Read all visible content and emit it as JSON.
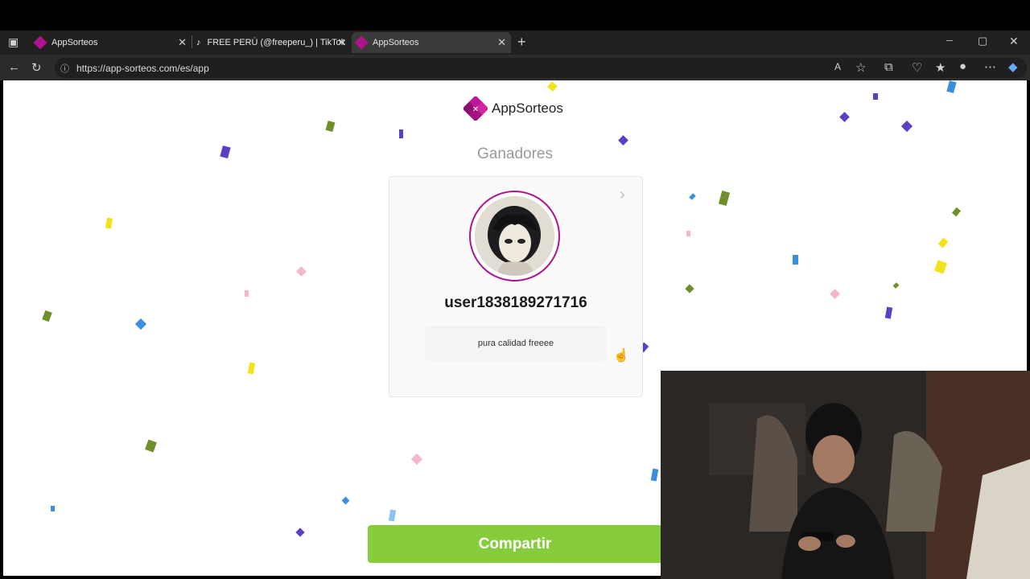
{
  "browser": {
    "tabs": [
      {
        "title": "AppSorteos",
        "active": false
      },
      {
        "title": "FREE PERÚ (@freeperu_) | TikTok",
        "active": false
      },
      {
        "title": "AppSorteos",
        "active": true
      }
    ],
    "new_tab": "+",
    "url": "https://app-sorteos.com/es/app",
    "window_controls": {
      "minimize": "─",
      "maximize": "▢",
      "close": "✕"
    }
  },
  "app": {
    "brand": "AppSorteos",
    "heading": "Ganadores",
    "winner": {
      "username": "user1838189271716",
      "comment": "pura calidad freeee"
    },
    "share_label": "Compartir"
  },
  "colors": {
    "brand_magenta": "#b0148a",
    "share_green": "#86cc3b",
    "confetti": [
      "#5b3fc4",
      "#6e8f2a",
      "#f2e21a",
      "#3a8fe0",
      "#f4b6c9"
    ]
  }
}
